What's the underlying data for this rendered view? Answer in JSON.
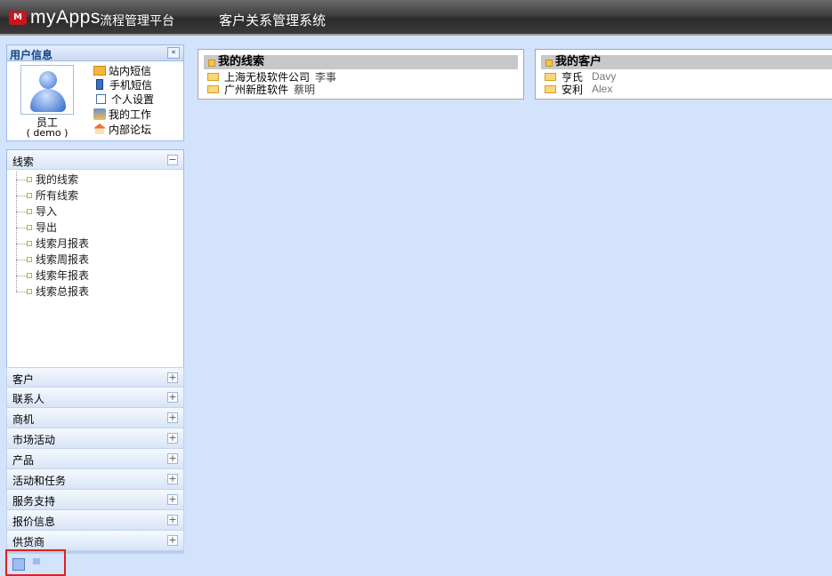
{
  "header": {
    "logo_icon_text": "M",
    "logo_text": "myApps",
    "logo_sub": "流程管理平台",
    "system_title": "客户关系管理系统"
  },
  "user_panel": {
    "title": "用户信息",
    "collapse_glyph": "«",
    "user_name": "员工",
    "user_login": "( demo )",
    "links": [
      "站内短信",
      "手机短信",
      "个人设置",
      "我的工作",
      "内部论坛"
    ]
  },
  "lead_panel": {
    "title": "线索",
    "toggle": "−",
    "items": [
      "我的线索",
      "所有线索",
      "导入",
      "导出",
      "线索月报表",
      "线索周报表",
      "线索年报表",
      "线索总报表"
    ]
  },
  "collapsed_modules": {
    "toggle": "+",
    "items": [
      "客户",
      "联系人",
      "商机",
      "市场活动",
      "产品",
      "活动和任务",
      "服务支持",
      "报价信息",
      "供货商"
    ]
  },
  "portlets": {
    "leads": {
      "title": "我的线索",
      "rows": [
        {
          "company": "上海无极软件公司",
          "person": "李事"
        },
        {
          "company": "广州新胜软件",
          "person": "蔡明"
        }
      ]
    },
    "customers": {
      "title": "我的客户",
      "rows": [
        {
          "name": "亨氏",
          "en": "Davy"
        },
        {
          "name": "安利",
          "en": "Alex"
        }
      ]
    }
  }
}
